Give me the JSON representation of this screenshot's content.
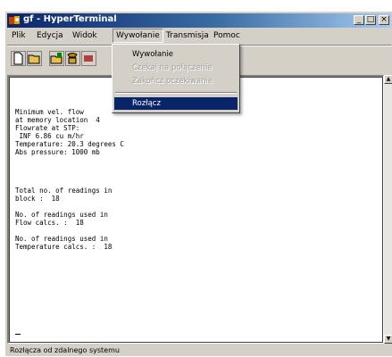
{
  "window": {
    "title": "gf - HyperTerminal",
    "controls": {
      "minimize": "_",
      "maximize": "□",
      "close": "×"
    }
  },
  "menubar": {
    "items": [
      {
        "label": "Plik"
      },
      {
        "label": "Edycja"
      },
      {
        "label": "Widok"
      },
      {
        "label": "Wywołanie"
      },
      {
        "label": "Transmisja"
      },
      {
        "label": "Pomoc"
      }
    ]
  },
  "dropdown": {
    "items": [
      {
        "label": "Wywołanie",
        "state": "enabled"
      },
      {
        "label": "Czekaj na połączenie",
        "state": "disabled"
      },
      {
        "label": "Zakończ oczekiwanie",
        "state": "disabled"
      },
      {
        "label": "Rozłącz",
        "state": "selected"
      }
    ]
  },
  "terminal": {
    "lines": [
      "Minimum vel. flow",
      "at memory location  4",
      "Flowrate at STP:",
      " INF 6.86 cu m/hr",
      "Temperature: 20.3 degrees C",
      "Abs pressure: 1000 mb",
      "",
      "",
      "Total no. of readings in",
      "block :  18",
      "",
      "No. of readings used in",
      "Flow calcs. :  18",
      "",
      "No. of readings used in",
      "Temperature calcs. :  18"
    ]
  },
  "statusbar": {
    "text": "Rozłącza od zdalnego systemu"
  },
  "icons": {
    "toolbar": [
      "new-file-icon",
      "open-folder-icon",
      "open-session-icon",
      "phone-icon",
      "disconnect-icon"
    ]
  },
  "colors": {
    "title_gradient_start": "#0a246a",
    "title_gradient_end": "#a6caf0",
    "window_face": "#d4d0c8",
    "menu_highlight": "#0a246a"
  }
}
